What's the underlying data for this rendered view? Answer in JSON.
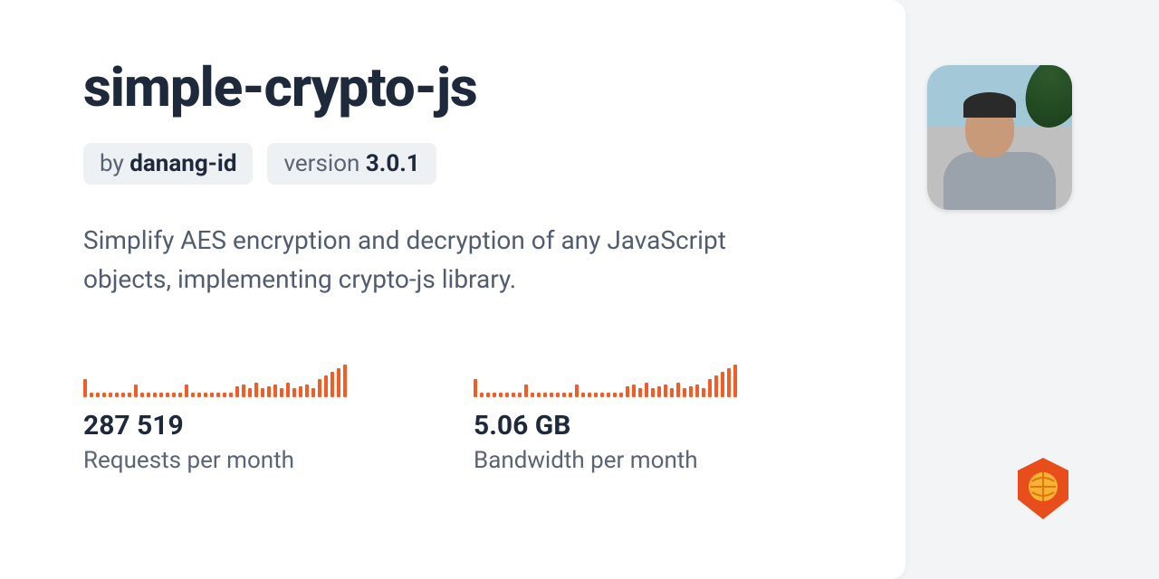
{
  "package": {
    "name": "simple-crypto-js",
    "author_prefix": "by ",
    "author": "danang-id",
    "version_prefix": "version ",
    "version": "3.0.1",
    "description": "Simplify AES encryption and decryption of any JavaScript objects, implementing crypto-js library."
  },
  "stats": {
    "requests": {
      "value": "287 519",
      "label": "Requests per month"
    },
    "bandwidth": {
      "value": "5.06 GB",
      "label": "Bandwidth per month"
    }
  },
  "chart_data": [
    {
      "type": "bar",
      "title": "Requests sparkline",
      "categories": null,
      "values": [
        20,
        5,
        5,
        5,
        5,
        5,
        5,
        5,
        14,
        5,
        5,
        5,
        5,
        5,
        5,
        5,
        14,
        5,
        5,
        5,
        5,
        5,
        5,
        5,
        12,
        14,
        10,
        16,
        10,
        12,
        14,
        10,
        16,
        10,
        12,
        14,
        10,
        20,
        24,
        28,
        32,
        36
      ]
    },
    {
      "type": "bar",
      "title": "Bandwidth sparkline",
      "categories": null,
      "values": [
        20,
        5,
        5,
        5,
        5,
        5,
        5,
        5,
        14,
        5,
        5,
        5,
        5,
        5,
        5,
        5,
        14,
        5,
        5,
        5,
        5,
        5,
        5,
        5,
        12,
        14,
        10,
        16,
        10,
        12,
        14,
        10,
        16,
        10,
        12,
        14,
        10,
        20,
        24,
        28,
        32,
        36
      ]
    }
  ],
  "colors": {
    "accent": "#f25d27",
    "text_dark": "#1e293b",
    "text_muted": "#5b6474",
    "chip_bg": "#eef1f4"
  }
}
